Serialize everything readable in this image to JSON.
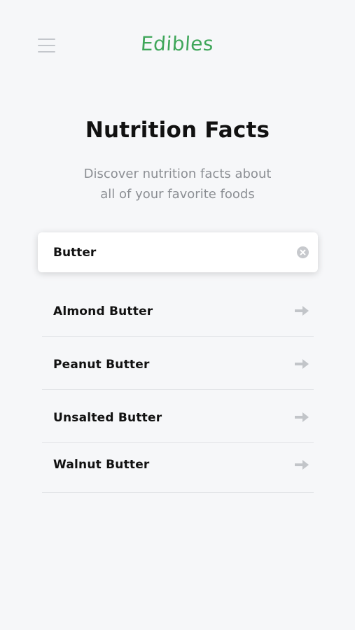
{
  "header": {
    "brand": "Edibles",
    "menu_icon": "hamburger-menu-icon"
  },
  "hero": {
    "title": "Nutrition Facts",
    "subtitle_line1": "Discover nutrition facts about",
    "subtitle_line2": "all of your favorite foods"
  },
  "search": {
    "value": "Butter",
    "clear_icon": "clear-circle-icon"
  },
  "results": [
    {
      "label": "Almond Butter",
      "icon": "arrow-right-icon"
    },
    {
      "label": "Peanut Butter",
      "icon": "arrow-right-icon"
    },
    {
      "label": "Unsalted Butter",
      "icon": "arrow-right-icon"
    },
    {
      "label": "Walnut Butter",
      "icon": "arrow-right-icon"
    }
  ],
  "colors": {
    "brand": "#3fa65a",
    "background": "#f6f7f9",
    "muted_text": "#8c8f94",
    "icon_gray": "#c7c9cd"
  }
}
